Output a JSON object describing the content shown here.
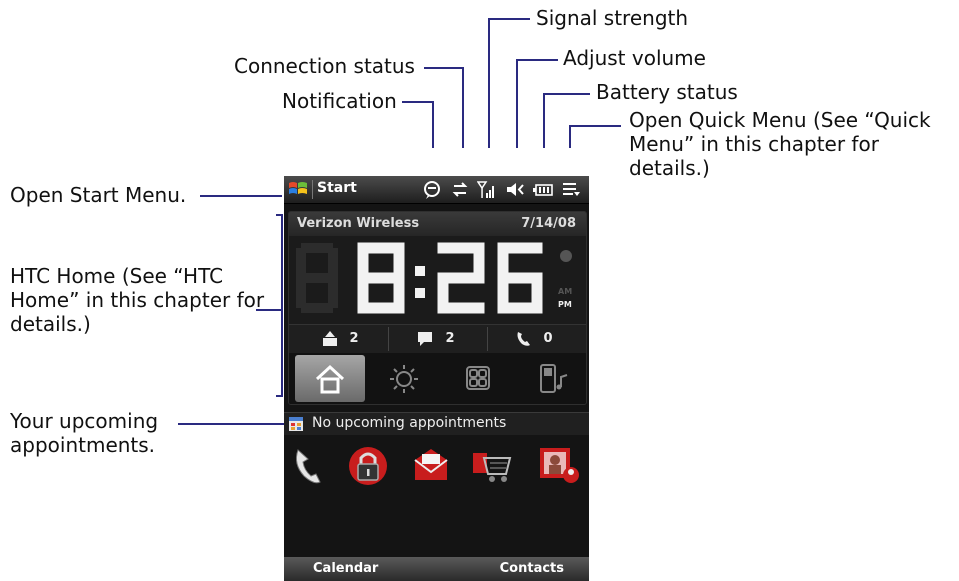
{
  "callouts": {
    "signal_strength": "Signal strength",
    "connection_status": "Connection status",
    "adjust_volume": "Adjust volume",
    "notification": "Notification",
    "battery_status": "Battery status",
    "quick_menu": "Open Quick Menu (See “Quick Menu” in this chapter for details.)",
    "start_menu": "Open Start Menu.",
    "htc_home": "HTC Home (See “HTC Home” in this chapter for details.)",
    "appointments": "Your upcoming appointments."
  },
  "taskbar": {
    "start_label": "Start",
    "icons": [
      "notification-icon",
      "connection-icon",
      "signal-icon",
      "volume-icon",
      "battery-icon",
      "quick-menu-icon"
    ]
  },
  "home": {
    "carrier": "Verizon Wireless",
    "date": "7/14/08",
    "time": "8:26",
    "ampm": [
      "AM",
      "PM"
    ],
    "counts": [
      {
        "icon": "voicemail-icon",
        "value": "2"
      },
      {
        "icon": "message-icon",
        "value": "2"
      },
      {
        "icon": "missed-call-icon",
        "value": "0"
      }
    ],
    "tabs": [
      "home-tab-icon",
      "weather-tab-icon",
      "launcher-tab-icon",
      "music-tab-icon"
    ]
  },
  "appointments": {
    "text": "No upcoming appointments"
  },
  "quick_launch": [
    "phone-icon",
    "lock-icon",
    "mail-icon",
    "shop-icon",
    "contacts-icon"
  ],
  "softkeys": {
    "left": "Calendar",
    "right": "Contacts"
  },
  "colors": {
    "callout_line": "#2a2a80",
    "background": "#ffffff",
    "phone_bg": "#141414",
    "accent_red": "#cc1a1a"
  }
}
